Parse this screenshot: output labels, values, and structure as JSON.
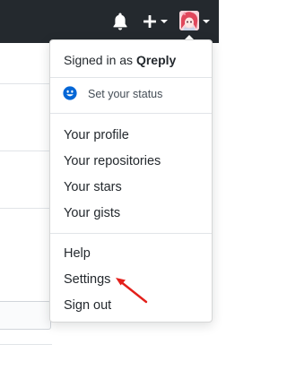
{
  "colors": {
    "header_bg": "#24292e",
    "status_icon": "#0366d6",
    "annotation_arrow": "#e3201b"
  },
  "header": {
    "notifications_icon": "bell-icon",
    "create_icon": "plus-icon",
    "avatar_icon": "user-avatar"
  },
  "dropdown": {
    "signed_in_prefix": "Signed in as",
    "username": "Qreply",
    "status_icon": "smiley-icon",
    "status_label": "Set your status",
    "profile_items": [
      "Your profile",
      "Your repositories",
      "Your stars",
      "Your gists"
    ],
    "account_items": [
      "Help",
      "Settings",
      "Sign out"
    ]
  },
  "annotation": {
    "icon": "red-arrow-pointing-at-settings"
  }
}
